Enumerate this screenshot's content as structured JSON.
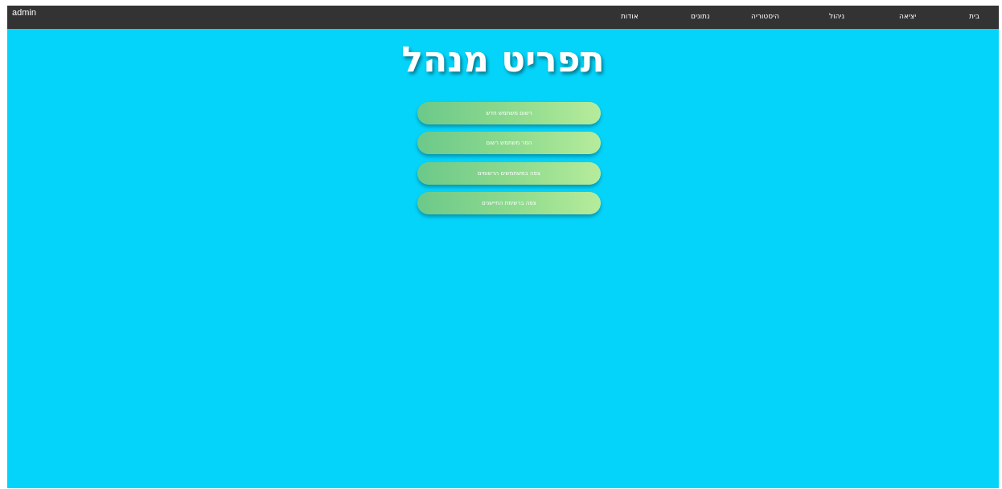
{
  "navbar": {
    "user": "admin",
    "items": {
      "about": "אודות",
      "data": "נתונים",
      "history": "היסטוריה",
      "admin": "ניהול",
      "logout": "יציאה",
      "home": "בית"
    }
  },
  "main": {
    "title": "תפריט מנהל",
    "buttons": [
      "רשום משתמש חדש",
      "הסר משתמש רשום",
      "צפה במשתמשים הרשומים",
      "צפה ברשימת החיישנים"
    ]
  },
  "colors": {
    "background": "#05d4fa",
    "navbar": "#333333",
    "button_start": "#6cc98a",
    "button_end": "#b6ec9b"
  }
}
